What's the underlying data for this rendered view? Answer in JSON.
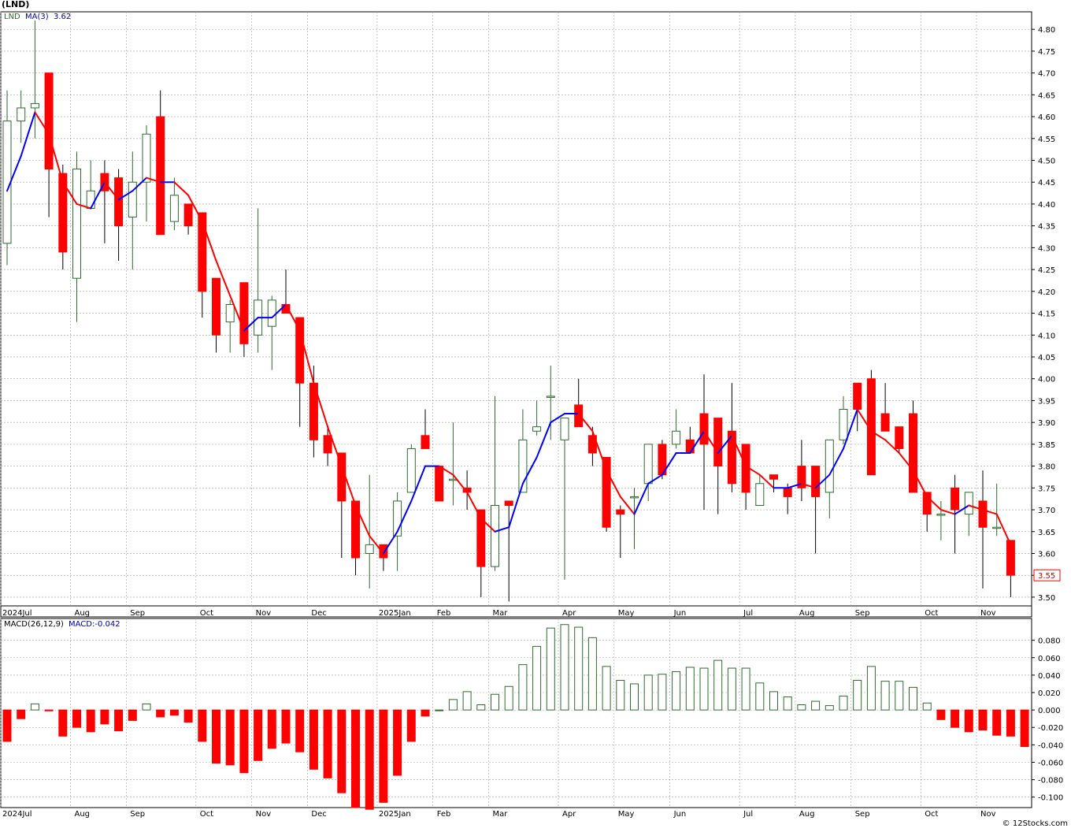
{
  "title": "(LND)",
  "credit": "© 12Stocks.com",
  "colors": {
    "up": "#2e6b2e",
    "down": "#ff0000",
    "ma_up": "#0000ff",
    "ma_down": "#ff0000",
    "grid": "#a0a0a0",
    "last_price_box": "#ff0000"
  },
  "price_panel": {
    "legend_symbol": "LND",
    "legend_ma": "MA(3)",
    "legend_ma_value": "3.62",
    "last_price": "3.55",
    "ylim": [
      3.48,
      4.84
    ],
    "yticks": [
      "3.50",
      "3.55",
      "3.60",
      "3.65",
      "3.70",
      "3.75",
      "3.80",
      "3.85",
      "3.90",
      "3.95",
      "4.00",
      "4.05",
      "4.10",
      "4.15",
      "4.20",
      "4.25",
      "4.30",
      "4.35",
      "4.40",
      "4.45",
      "4.50",
      "4.55",
      "4.60",
      "4.65",
      "4.70",
      "4.75",
      "4.80"
    ],
    "xticks": [
      {
        "label": "2024Jul",
        "i": 0
      },
      {
        "label": "Aug",
        "i": 5
      },
      {
        "label": "Sep",
        "i": 9
      },
      {
        "label": "Oct",
        "i": 14
      },
      {
        "label": "Nov",
        "i": 18
      },
      {
        "label": "Dec",
        "i": 22
      },
      {
        "label": "2025Jan",
        "i": 27
      },
      {
        "label": "Feb",
        "i": 31
      },
      {
        "label": "Mar",
        "i": 35
      },
      {
        "label": "Apr",
        "i": 40
      },
      {
        "label": "May",
        "i": 44
      },
      {
        "label": "Jun",
        "i": 48
      },
      {
        "label": "Jul",
        "i": 53
      },
      {
        "label": "Aug",
        "i": 57
      },
      {
        "label": "Sep",
        "i": 61
      },
      {
        "label": "Oct",
        "i": 66
      },
      {
        "label": "Nov",
        "i": 70
      }
    ]
  },
  "macd_panel": {
    "legend_name": "MACD(26,12,9)",
    "legend_value": "MACD:-0.042",
    "ylim": [
      -0.112,
      0.105
    ],
    "yticks": [
      "0.080",
      "0.060",
      "0.040",
      "0.020",
      "0.000",
      "-0.020",
      "-0.040",
      "-0.060",
      "-0.080",
      "-0.100"
    ]
  },
  "chart_data": {
    "type": "candlestick",
    "period": "weekly",
    "ohlc": [
      [
        4.31,
        4.66,
        4.26,
        4.59
      ],
      [
        4.59,
        4.66,
        4.54,
        4.62
      ],
      [
        4.62,
        4.82,
        4.55,
        4.63
      ],
      [
        4.7,
        4.7,
        4.37,
        4.48
      ],
      [
        4.47,
        4.49,
        4.25,
        4.29
      ],
      [
        4.23,
        4.52,
        4.13,
        4.48
      ],
      [
        4.39,
        4.5,
        4.39,
        4.43
      ],
      [
        4.47,
        4.5,
        4.31,
        4.43
      ],
      [
        4.46,
        4.48,
        4.27,
        4.35
      ],
      [
        4.37,
        4.52,
        4.25,
        4.45
      ],
      [
        4.45,
        4.58,
        4.36,
        4.56
      ],
      [
        4.6,
        4.66,
        4.33,
        4.33
      ],
      [
        4.36,
        4.46,
        4.34,
        4.42
      ],
      [
        4.4,
        4.4,
        4.33,
        4.35
      ],
      [
        4.38,
        4.38,
        4.14,
        4.2
      ],
      [
        4.23,
        4.23,
        4.06,
        4.1
      ],
      [
        4.13,
        4.18,
        4.06,
        4.17
      ],
      [
        4.22,
        4.22,
        4.05,
        4.08
      ],
      [
        4.1,
        4.39,
        4.06,
        4.18
      ],
      [
        4.12,
        4.19,
        4.02,
        4.18
      ],
      [
        4.17,
        4.25,
        4.15,
        4.15
      ],
      [
        4.14,
        4.14,
        3.89,
        3.99
      ],
      [
        3.99,
        4.03,
        3.82,
        3.86
      ],
      [
        3.87,
        3.89,
        3.8,
        3.83
      ],
      [
        3.83,
        3.83,
        3.59,
        3.72
      ],
      [
        3.72,
        3.72,
        3.55,
        3.59
      ],
      [
        3.6,
        3.78,
        3.52,
        3.62
      ],
      [
        3.62,
        3.62,
        3.56,
        3.59
      ],
      [
        3.64,
        3.74,
        3.56,
        3.72
      ],
      [
        3.74,
        3.85,
        3.74,
        3.84
      ],
      [
        3.87,
        3.93,
        3.84,
        3.84
      ],
      [
        3.8,
        3.8,
        3.72,
        3.72
      ],
      [
        3.77,
        3.9,
        3.71,
        3.77
      ],
      [
        3.75,
        3.79,
        3.7,
        3.74
      ],
      [
        3.7,
        3.7,
        3.5,
        3.57
      ],
      [
        3.57,
        3.96,
        3.56,
        3.71
      ],
      [
        3.72,
        3.72,
        3.49,
        3.71
      ],
      [
        3.74,
        3.93,
        3.74,
        3.86
      ],
      [
        3.88,
        3.95,
        3.87,
        3.89
      ],
      [
        3.96,
        4.03,
        3.86,
        3.96
      ],
      [
        3.86,
        3.91,
        3.54,
        3.91
      ],
      [
        3.94,
        4.0,
        3.89,
        3.89
      ],
      [
        3.87,
        3.89,
        3.8,
        3.83
      ],
      [
        3.82,
        3.82,
        3.65,
        3.66
      ],
      [
        3.7,
        3.71,
        3.59,
        3.69
      ],
      [
        3.73,
        3.75,
        3.61,
        3.73
      ],
      [
        3.76,
        3.85,
        3.72,
        3.85
      ],
      [
        3.85,
        3.86,
        3.77,
        3.78
      ],
      [
        3.85,
        3.93,
        3.84,
        3.88
      ],
      [
        3.86,
        3.89,
        3.83,
        3.83
      ],
      [
        3.92,
        4.01,
        3.7,
        3.85
      ],
      [
        3.91,
        3.91,
        3.69,
        3.8
      ],
      [
        3.88,
        3.99,
        3.74,
        3.76
      ],
      [
        3.85,
        3.85,
        3.7,
        3.74
      ],
      [
        3.71,
        3.78,
        3.71,
        3.76
      ],
      [
        3.78,
        3.78,
        3.74,
        3.77
      ],
      [
        3.75,
        3.76,
        3.69,
        3.73
      ],
      [
        3.8,
        3.86,
        3.72,
        3.75
      ],
      [
        3.8,
        3.8,
        3.6,
        3.73
      ],
      [
        3.74,
        3.86,
        3.68,
        3.86
      ],
      [
        3.86,
        3.96,
        3.85,
        3.93
      ],
      [
        3.99,
        3.99,
        3.88,
        3.93
      ],
      [
        4.0,
        4.02,
        3.78,
        3.78
      ],
      [
        3.92,
        3.99,
        3.88,
        3.88
      ],
      [
        3.89,
        3.89,
        3.83,
        3.84
      ],
      [
        3.92,
        3.95,
        3.74,
        3.74
      ],
      [
        3.74,
        3.74,
        3.65,
        3.69
      ],
      [
        3.69,
        3.72,
        3.63,
        3.69
      ],
      [
        3.75,
        3.78,
        3.6,
        3.7
      ],
      [
        3.69,
        3.74,
        3.64,
        3.74
      ],
      [
        3.72,
        3.79,
        3.52,
        3.66
      ],
      [
        3.66,
        3.76,
        3.64,
        3.66
      ],
      [
        3.63,
        3.63,
        3.5,
        3.55
      ]
    ],
    "ma3": [
      4.43,
      4.51,
      4.61,
      4.56,
      4.45,
      4.4,
      4.39,
      4.45,
      4.41,
      4.43,
      4.46,
      4.45,
      4.45,
      4.42,
      4.36,
      4.27,
      4.19,
      4.11,
      4.14,
      4.14,
      4.17,
      4.11,
      3.99,
      3.89,
      3.8,
      3.71,
      3.64,
      3.6,
      3.65,
      3.72,
      3.8,
      3.8,
      3.78,
      3.74,
      3.68,
      3.65,
      3.66,
      3.76,
      3.82,
      3.9,
      3.92,
      3.92,
      3.88,
      3.79,
      3.73,
      3.69,
      3.76,
      3.78,
      3.83,
      3.83,
      3.88,
      3.83,
      3.87,
      3.8,
      3.78,
      3.75,
      3.75,
      3.76,
      3.75,
      3.78,
      3.84,
      3.93,
      3.88,
      3.86,
      3.83,
      3.79,
      3.73,
      3.7,
      3.69,
      3.71,
      3.7,
      3.69,
      3.62
    ],
    "macd": [
      -0.036,
      -0.01,
      0.007,
      -0.001,
      -0.03,
      -0.02,
      -0.025,
      -0.016,
      -0.024,
      -0.012,
      0.007,
      -0.008,
      -0.006,
      -0.014,
      -0.036,
      -0.061,
      -0.063,
      -0.072,
      -0.058,
      -0.044,
      -0.038,
      -0.048,
      -0.068,
      -0.078,
      -0.095,
      -0.112,
      -0.114,
      -0.106,
      -0.075,
      -0.036,
      -0.007,
      0.0,
      0.012,
      0.021,
      0.006,
      0.018,
      0.027,
      0.052,
      0.073,
      0.094,
      0.098,
      0.095,
      0.083,
      0.05,
      0.034,
      0.03,
      0.04,
      0.041,
      0.044,
      0.049,
      0.048,
      0.057,
      0.048,
      0.048,
      0.031,
      0.021,
      0.015,
      0.006,
      0.01,
      0.005,
      0.016,
      0.034,
      0.05,
      0.033,
      0.033,
      0.026,
      0.008,
      -0.011,
      -0.02,
      -0.025,
      -0.023,
      -0.029,
      -0.03,
      -0.042
    ]
  }
}
